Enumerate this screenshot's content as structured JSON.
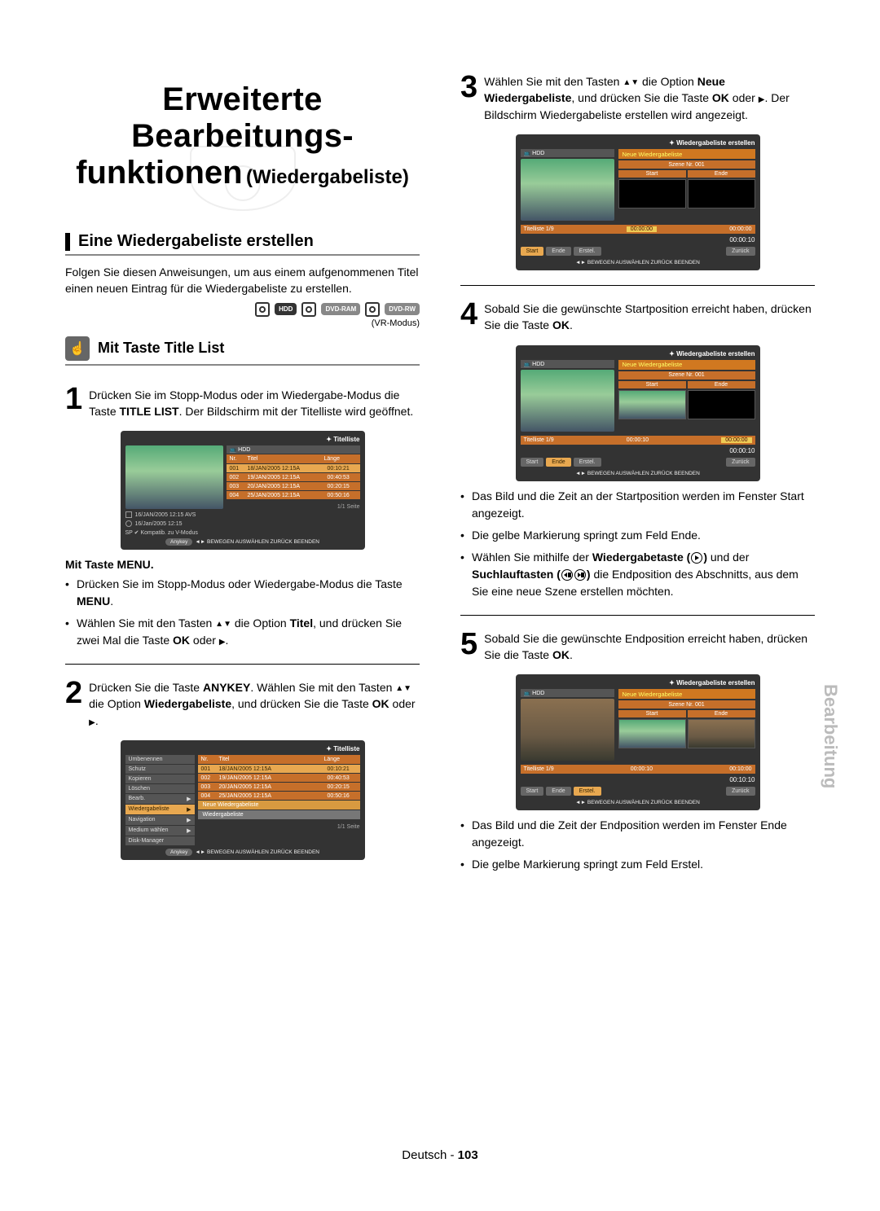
{
  "title": {
    "line1": "Erweiterte Bearbeitungs-",
    "line2_main": "funktionen",
    "line2_sub": "(Wiedergabeliste)"
  },
  "section1": {
    "heading": "Eine Wiedergabeliste erstellen",
    "intro": "Folgen Sie diesen Anweisungen, um aus einem aufgenommenen Titel einen neuen Eintrag für die Wiedergabeliste zu erstellen.",
    "media": {
      "hdd": "HDD",
      "dvdram": "DVD-RAM",
      "dvdrw": "DVD-RW",
      "vr": "(VR-Modus)"
    },
    "sub_heading": "Mit Taste Title List"
  },
  "steps": {
    "s1": {
      "num": "1",
      "text_a": "Drücken Sie im Stopp-Modus oder im Wiedergabe-Modus die Taste ",
      "bold_a": "TITLE LIST",
      "text_b": ". Der Bildschirm mit der Titelliste wird geöffnet."
    },
    "s1_menu": {
      "label": "Mit Taste MENU.",
      "b1_a": "Drücken Sie im Stopp-Modus oder Wiedergabe-Modus die Taste ",
      "b1_b": "MENU",
      "b2_a": "Wählen Sie mit den Tasten ",
      "b2_b": " die Option ",
      "b2_c": "Titel",
      "b2_d": ", und drücken Sie zwei Mal die Taste ",
      "b2_e": "OK",
      "b2_f": " oder "
    },
    "s2": {
      "num": "2",
      "a": "Drücken Sie die Taste ",
      "b": "ANYKEY",
      "c": ". Wählen Sie mit den Tasten ",
      "d": " die Option ",
      "e": "Wiedergabeliste",
      "f": ", und drücken Sie die Taste ",
      "g": "OK",
      "h": " oder "
    },
    "s3": {
      "num": "3",
      "a": "Wählen Sie mit den Tasten ",
      "b": " die Option ",
      "c": "Neue Wiedergabeliste",
      "d": ", und drücken Sie die Taste ",
      "e": "OK",
      "f": " oder ",
      "g": ". Der Bildschirm Wiedergabeliste erstellen wird angezeigt."
    },
    "s4": {
      "num": "4",
      "a": "Sobald Sie die gewünschte Startposition erreicht haben, drücken Sie die Taste ",
      "b": "OK"
    },
    "s4_bullets": {
      "b1": "Das Bild und die Zeit an der Startposition werden im Fenster Start angezeigt.",
      "b2": "Die gelbe Markierung springt zum Feld Ende.",
      "b3_a": "Wählen Sie mithilfe der ",
      "b3_b": "Wiedergabetaste (",
      "b3_c": ") ",
      "b3_d": "und der ",
      "b3_e": "Suchlauftasten (",
      "b3_f": ") ",
      "b3_g": "die Endposition des Abschnitts, aus dem Sie eine neue Szene erstellen möchten."
    },
    "s5": {
      "num": "5",
      "a": "Sobald Sie die gewünschte Endposition erreicht haben, drücken Sie die Taste ",
      "b": "OK"
    },
    "s5_bullets": {
      "b1": "Das Bild und die Zeit der Endposition werden im Fenster Ende angezeigt.",
      "b2": "Die gelbe Markierung springt zum Feld Erstel."
    }
  },
  "osd_titlelist": {
    "title": "Titelliste",
    "hdd": "HDD",
    "head": {
      "nr": "Nr.",
      "titel": "Titel",
      "laenge": "Länge"
    },
    "rows": [
      {
        "nr": "001",
        "titel": "18/JAN/2005 12:15A",
        "laenge": "00:10:21"
      },
      {
        "nr": "002",
        "titel": "19/JAN/2005 12:15A",
        "laenge": "00:40:53"
      },
      {
        "nr": "003",
        "titel": "20/JAN/2005 12:15A",
        "laenge": "00:20:15"
      },
      {
        "nr": "004",
        "titel": "25/JAN/2005 12:15A",
        "laenge": "00:50:16"
      }
    ],
    "cap1": "16/JAN/2005 12:15 AVS",
    "cap2": "16/Jan/2005 12:15",
    "cap3": "SP ✔ Kompatib. zu V-Modus",
    "page": "1/1 Seite",
    "nav": "BEWEGEN   AUSWÄHLEN   ZURÜCK   BEENDEN",
    "anykey": "Anykey"
  },
  "osd_menu": {
    "title": "Titelliste",
    "items": [
      "Umbenennen",
      "Schutz",
      "Kopieren",
      "Löschen",
      "Bearb.",
      "Wiedergabeliste",
      "Navigation",
      "Medium wählen",
      "Disk-Manager"
    ],
    "submenu": [
      "Neue Wiedergabeliste",
      "Wiedergabeliste"
    ],
    "page": "1/1 Seite",
    "nav": "BEWEGEN   AUSWÄHLEN   ZURÜCK   BEENDEN",
    "anykey": "Anykey"
  },
  "osd_playlist": {
    "title": "Wiedergabeliste erstellen",
    "hdd": "HDD",
    "new_pl": "Neue Wiedergabeliste",
    "scene": "Szene Nr. 001",
    "start": "Start",
    "ende": "Ende",
    "list": "Titelliste 1/9",
    "t_start_0": "00:00:00",
    "t_end_0": "00:00:00",
    "t_start_1": "00:00:10",
    "t_end_1": "00:00:00",
    "t_start_2": "00:00:10",
    "t_end_2": "00:10:00",
    "timer0": "00:00:10",
    "timer1": "00:00:10",
    "timer2": "00:10:10",
    "btn_start": "Start",
    "btn_ende": "Ende",
    "btn_erstel": "Erstel.",
    "btn_zurueck": "Zurück",
    "nav": "BEWEGEN   AUSWÄHLEN   ZURÜCK   BEENDEN"
  },
  "side_tab": "Bearbeitung",
  "footer": {
    "lang": "Deutsch",
    "sep": " - ",
    "page": "103"
  }
}
